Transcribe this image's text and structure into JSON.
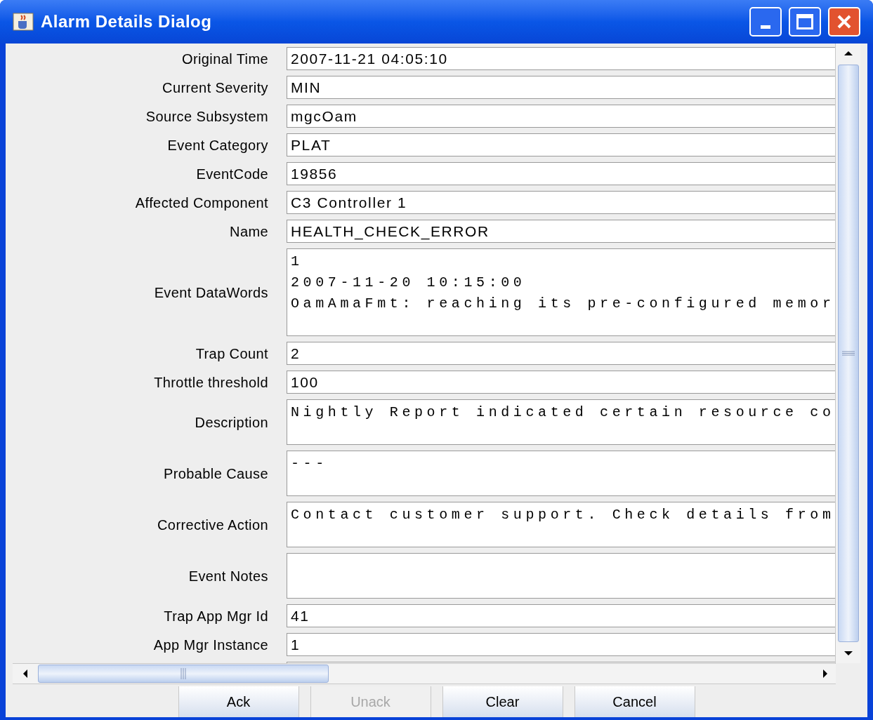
{
  "window": {
    "title": "Alarm Details Dialog"
  },
  "fields": [
    {
      "label": "Original Time",
      "kind": "line",
      "value": "2007-11-21 04:05:10"
    },
    {
      "label": "Current Severity",
      "kind": "line",
      "value": "MIN"
    },
    {
      "label": "Source Subsystem",
      "kind": "line",
      "value": "mgcOam"
    },
    {
      "label": "Event Category",
      "kind": "line",
      "value": "PLAT"
    },
    {
      "label": "EventCode",
      "kind": "line",
      "value": "19856"
    },
    {
      "label": "Affected Component",
      "kind": "line",
      "value": "C3 Controller 1"
    },
    {
      "label": "Name",
      "kind": "line",
      "value": "HEALTH_CHECK_ERROR"
    },
    {
      "label": "Event DataWords",
      "kind": "area",
      "lines": [
        "1",
        "2007-11-20 10:15:00",
        "OamAmaFmt: reaching its pre-configured memor"
      ]
    },
    {
      "label": "Trap Count",
      "kind": "line",
      "value": "2"
    },
    {
      "label": "Throttle threshold",
      "kind": "line",
      "value": "100"
    },
    {
      "label": "Description",
      "kind": "area",
      "lines": [
        "Nightly Report indicated certain resource co"
      ]
    },
    {
      "label": "Probable Cause",
      "kind": "area",
      "lines": [
        "---"
      ]
    },
    {
      "label": "Corrective Action",
      "kind": "area",
      "lines": [
        "Contact customer support. Check details from"
      ]
    },
    {
      "label": "Event Notes",
      "kind": "area"
    },
    {
      "label": "Trap App Mgr Id",
      "kind": "line",
      "value": "41"
    },
    {
      "label": "App Mgr Instance",
      "kind": "line",
      "value": "1"
    },
    {
      "kind": "line"
    }
  ],
  "buttons": [
    {
      "label": "Ack",
      "disabled": false
    },
    {
      "label": "Unack",
      "disabled": true
    },
    {
      "label": "Clear",
      "disabled": false
    },
    {
      "label": "Cancel",
      "disabled": false
    }
  ]
}
